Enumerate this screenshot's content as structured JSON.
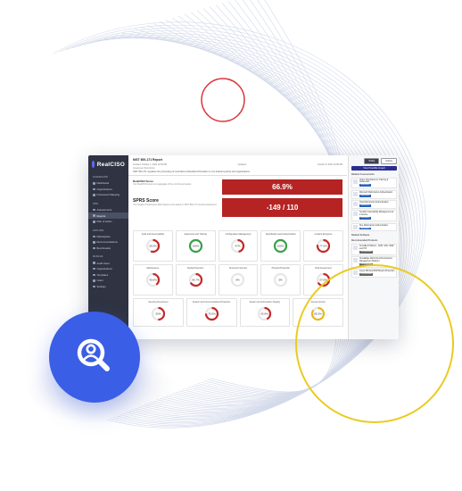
{
  "app": {
    "name": "RealCISO"
  },
  "sidebar": {
    "sections": [
      {
        "title": "DASHBOARD",
        "items": [
          "Dashboard",
          "Organizations",
          "Framework Mapping"
        ]
      },
      {
        "title": "RISK",
        "items": [
          "Assessments",
          "Reports",
          "Plan of Action"
        ]
      },
      {
        "title": "EXPLORE",
        "items": [
          "Marketplace",
          "Recommendations",
          "Benchmarks"
        ]
      },
      {
        "title": "MANAGE",
        "items": [
          "Audit Users",
          "Organizations",
          "Templates",
          "Users",
          "Settings"
        ]
      }
    ]
  },
  "report": {
    "title": "NIST 800-171 Report",
    "meta": [
      "Created: October 1, 2021  12:00 PM",
      "Updated:",
      "October 8, 2021  10:00 AM"
    ],
    "description_label": "Assessment Description",
    "description": "NIST 800-171 regulates the processing of controlled unclassified information in non-federal systems and organizations.",
    "scores": [
      {
        "label": "RealCISO Score",
        "sub": "Your RealCISO score is an aggregate of the controls and assets.",
        "value": "66.9%"
      },
      {
        "label": "SPRS Score",
        "sub": "Your Supplier Performance Risk System score based on NIST 800-171 controls assessment.",
        "value": "-149 / 110"
      }
    ]
  },
  "controls": {
    "row1": [
      {
        "name": "Audit and Accountability",
        "value": "55.5%",
        "pct": 0.555,
        "color": "#c32a2a"
      },
      {
        "name": "Awareness and Training",
        "value": "100%",
        "pct": 1.0,
        "color": "#3aa04a"
      },
      {
        "name": "Configuration Management",
        "value": "47%",
        "pct": 0.47,
        "color": "#c32a2a"
      },
      {
        "name": "Identification and Authentication",
        "value": "100%",
        "pct": 1.0,
        "color": "#3aa04a"
      },
      {
        "name": "Incident Response",
        "value": "77.6%",
        "pct": 0.776,
        "color": "#c32a2a"
      }
    ],
    "row2": [
      {
        "name": "Maintenance",
        "value": "40.0%",
        "pct": 0.4,
        "color": "#c32a2a"
      },
      {
        "name": "Media Protection",
        "value": "66.7%",
        "pct": 0.667,
        "color": "#c32a2a"
      },
      {
        "name": "Personnel Security",
        "value": "0%",
        "pct": 0.0,
        "color": "#c32a2a"
      },
      {
        "name": "Physical Protection",
        "value": "0%",
        "pct": 0.0,
        "color": "#c32a2a"
      },
      {
        "name": "Risk Assessment",
        "value": "67.0%",
        "pct": 0.67,
        "color": "#c32a2a"
      }
    ],
    "row3": [
      {
        "name": "Security Assessment",
        "value": "50%",
        "pct": 0.5,
        "color": "#c32a2a"
      },
      {
        "name": "System and Communications Protection",
        "value": "75.0%",
        "pct": 0.75,
        "color": "#c32a2a"
      },
      {
        "name": "System and Information Integrity",
        "value": "42.9%",
        "pct": 0.429,
        "color": "#c32a2a"
      },
      {
        "name": "Access Control",
        "value": "85.3%",
        "pct": 0.853,
        "color": "#e8b81e"
      }
    ]
  },
  "right_panel": {
    "buttons": [
      "Tooltip",
      "Actions"
    ],
    "primary": "View Possible Impact",
    "section1": "Related Assessments",
    "items": [
      {
        "text": "Under Operations by Training & Awareness",
        "tag": "Assessment"
      },
      {
        "text": "Microsoft Multi-Factor Authentication",
        "tag": "Assessment"
      },
      {
        "text": "Okta Multi-Factor Authentication",
        "tag": "Assessment"
      },
      {
        "text": "Tenable Vulnerability Management as a Service",
        "tag": "Assessment"
      },
      {
        "text": "Duo Multi-Factor Authentication",
        "tag": "Assessment"
      }
    ],
    "section2": "Related Software",
    "section3": "Recommended Products",
    "products": [
      {
        "text": "KnowBe4 Platform - KMS, SOC, EDR and ITR",
        "tag": "Recommended"
      },
      {
        "text": "CloudEdge Multi-Cloud Permissions Management Platform",
        "tag": "Recommended"
      },
      {
        "text": "Cynet 360 AutoXDR Breach Protection",
        "tag": "Recommended"
      }
    ]
  },
  "colors": {
    "accent": "#3b5ee6",
    "danger": "#b62323",
    "success": "#3aa04a",
    "warning": "#e8b81e",
    "sidebar": "#2f3342"
  },
  "hero_icon": "search-person-icon"
}
